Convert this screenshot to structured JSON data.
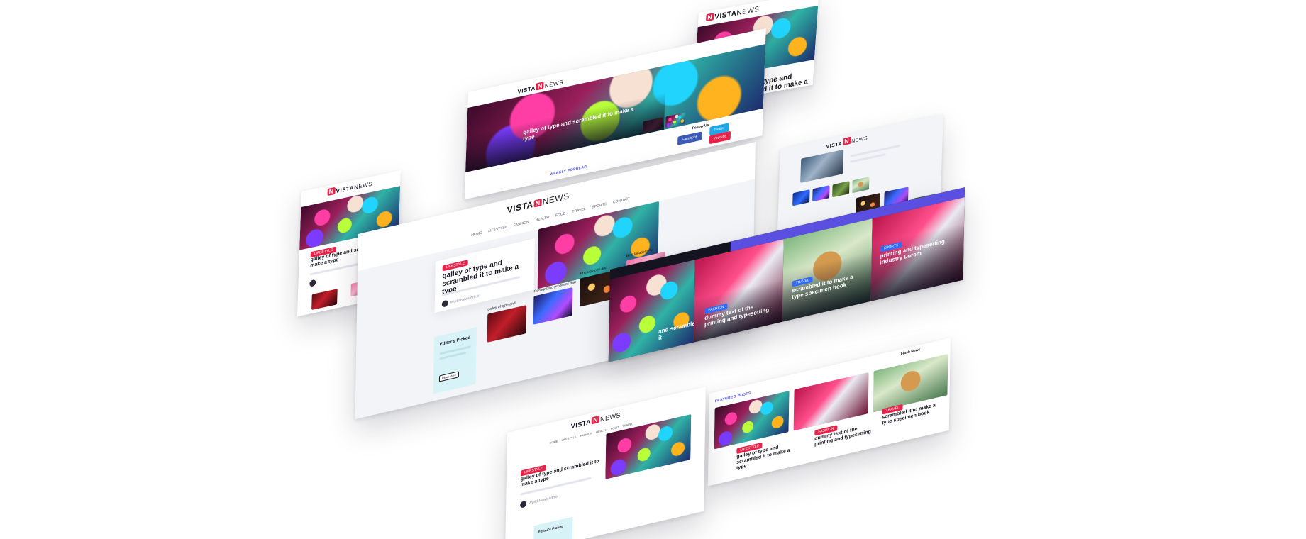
{
  "brand": {
    "logo_left": "VISTA",
    "logo_mark": "N",
    "logo_right": "NEWS",
    "accent": "#e8234a",
    "link_color": "#4b4fe0"
  },
  "nav": [
    "HOME",
    "LIFESTYLE",
    "FASHION",
    "HEALTH",
    "FOOD",
    "TRAVEL",
    "SPORTS",
    "CONTACT"
  ],
  "hero": {
    "category": "LIFESTYLE",
    "title": "galley of type and scrambled it to make a type",
    "author": "World News Admin"
  },
  "mobile_top": {
    "title": "galley of type and scrambled it to make a"
  },
  "mobile_left": {
    "title": "galley of type and scrambled it to make a type"
  },
  "wide_banner": {
    "title": "galley of type and scrambled it to make a type",
    "follow_label": "Follow Us",
    "buttons": [
      "Facebook",
      "Twitter",
      "Youtube"
    ],
    "section": "WEEKLY POPULAR"
  },
  "main_page": {
    "cards": [
      {
        "title": "galley of type and"
      },
      {
        "title": "Recognizing problems that"
      },
      {
        "title": "Photography and"
      },
      {
        "title": "Best locations for"
      }
    ],
    "editors_title": "Editor's Picked",
    "editors_button": "Read More"
  },
  "dark_strip": {
    "items": [
      {
        "title": "dummy text of the printing and typesetting",
        "badge": "FASHION"
      },
      {
        "title": "scrambled it to make a type specimen book",
        "badge": "TRAVEL"
      },
      {
        "title": "printing and typesetting industry Lorem",
        "badge": "SPORTS"
      }
    ],
    "left_title": "and scrambled it"
  },
  "featured": {
    "section": "FEATURED POSTS",
    "tabs_right": "Flash News",
    "items": [
      {
        "title": "galley of type and scrambled it to make a type",
        "badge": "LIFESTYLE"
      },
      {
        "title": "dummy text of the printing and typesetting",
        "badge": "FASHION"
      },
      {
        "title": "scrambled it to make a type specimen book",
        "badge": "TRAVEL"
      }
    ]
  },
  "bottom_page": {
    "title": "galley of type and scrambled it to make a type",
    "author": "World News Admin",
    "editors_title": "Editor's Picked"
  }
}
